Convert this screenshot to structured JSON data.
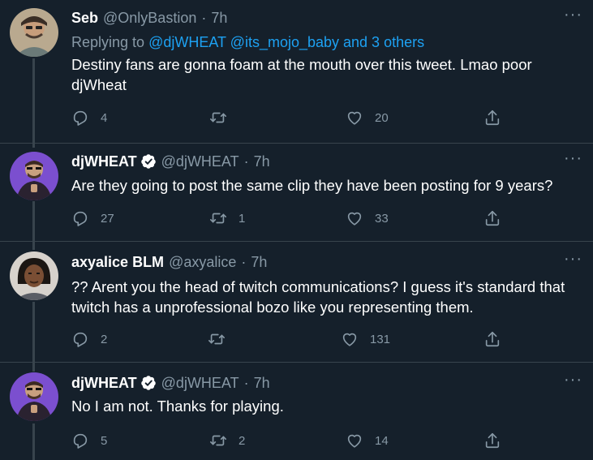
{
  "tweets": [
    {
      "name": "Seb",
      "handle": "@OnlyBastion",
      "sep": "·",
      "time": "7h",
      "verified": false,
      "replying_prefix": "Replying to ",
      "replying_links": "@djWHEAT @its_mojo_baby and 3 others",
      "text": "Destiny fans are gonna foam at the mouth over this tweet. Lmao poor djWheat",
      "reply_count": "4",
      "retweet_count": "",
      "like_count": "20",
      "avatar_bg": "#8a7a66"
    },
    {
      "name": "djWHEAT",
      "handle": "@djWHEAT",
      "sep": "·",
      "time": "7h",
      "verified": true,
      "text": "Are they going to post the same clip they have been posting for 9 years?",
      "reply_count": "27",
      "retweet_count": "1",
      "like_count": "33",
      "avatar_bg": "#6a3fb5"
    },
    {
      "name": "axyalice BLM",
      "handle": "@axyalice",
      "sep": "·",
      "time": "7h",
      "verified": false,
      "text": "?? Arent you the head of twitch communications? I guess it's standard that twitch has a unprofessional bozo like you representing them.",
      "reply_count": "2",
      "retweet_count": "",
      "like_count": "131",
      "avatar_bg": "#c9c4bd"
    },
    {
      "name": "djWHEAT",
      "handle": "@djWHEAT",
      "sep": "·",
      "time": "7h",
      "verified": true,
      "text": "No I am not. Thanks for playing.",
      "reply_count": "5",
      "retweet_count": "2",
      "like_count": "14",
      "avatar_bg": "#6a3fb5"
    }
  ],
  "colors": {
    "background": "#15202b",
    "secondary_text": "#8899a6",
    "link": "#1da1f2",
    "divider": "#38444d"
  },
  "icons": {
    "reply": "reply-icon",
    "retweet": "retweet-icon",
    "like": "heart-icon",
    "share": "share-icon",
    "more": "more-icon",
    "verified": "verified-badge-icon"
  }
}
